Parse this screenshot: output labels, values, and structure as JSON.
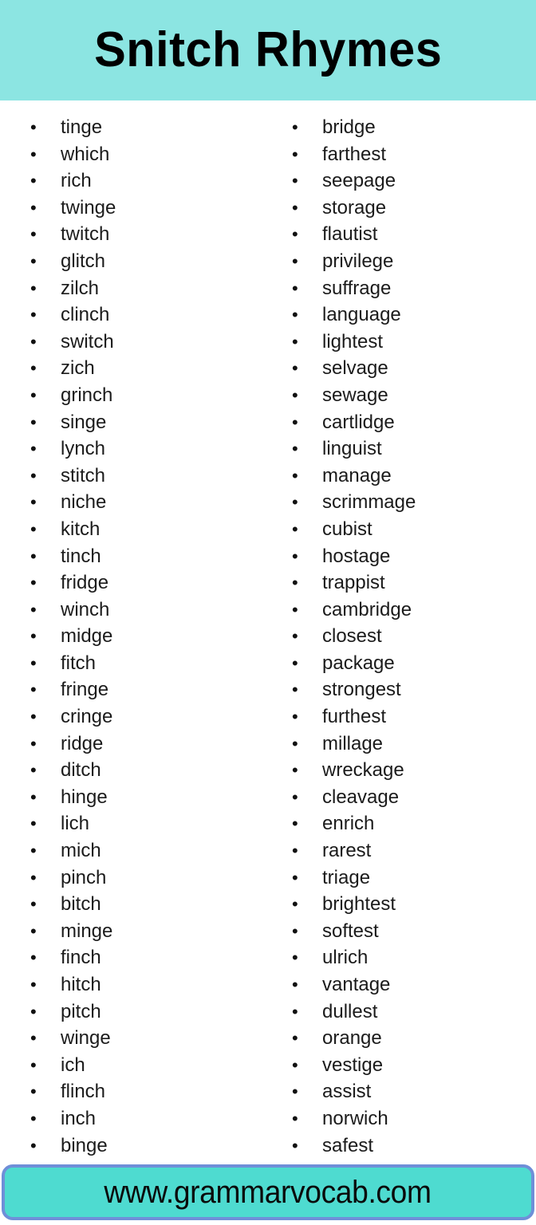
{
  "header": {
    "title": "Snitch Rhymes",
    "background_color": "#8ce5e2",
    "text_color": "#000000"
  },
  "bullet": {
    "glyph": "•"
  },
  "columns": [
    {
      "id": "left-column",
      "words": [
        "tinge",
        "which",
        "rich",
        "twinge",
        "twitch",
        "glitch",
        "zilch",
        "clinch",
        "switch",
        "zich",
        "grinch",
        "singe",
        "lynch",
        "stitch",
        "niche",
        "kitch",
        "tinch",
        "fridge",
        "winch",
        "midge",
        "fitch",
        "fringe",
        "cringe",
        "ridge",
        "ditch",
        "hinge",
        "lich",
        "mich",
        "pinch",
        "bitch",
        "minge",
        "finch",
        "hitch",
        "pitch",
        "winge",
        "ich",
        "flinch",
        "inch",
        "binge"
      ]
    },
    {
      "id": "right-column",
      "words": [
        "bridge",
        "farthest",
        "seepage",
        "storage",
        "flautist",
        "privilege",
        "suffrage",
        "language",
        "lightest",
        "selvage",
        "sewage",
        "cartlidge",
        "linguist",
        "manage",
        "scrimmage",
        "cubist",
        "hostage",
        "trappist",
        "cambridge",
        "closest",
        "package",
        "strongest",
        "furthest",
        "millage",
        "wreckage",
        "cleavage",
        "enrich",
        "rarest",
        "triage",
        "brightest",
        "softest",
        "ulrich",
        "vantage",
        "dullest",
        "orange",
        "vestige",
        "assist",
        "norwich",
        "safest"
      ]
    }
  ],
  "footer": {
    "url": "www.grammarvocab.com",
    "background_color": "#4edbd0",
    "border_color": "#6f8fd8",
    "text_color": "#0a0a0a"
  }
}
